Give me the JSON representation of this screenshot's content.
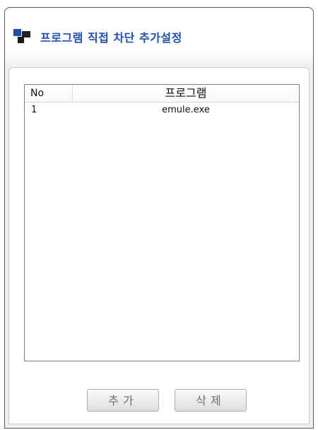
{
  "window": {
    "title": "프로그램 직접 차단 추가설정",
    "icon": "app-window-icon",
    "title_color": "#1c4fb8"
  },
  "list": {
    "columns": [
      "No",
      "프로그램"
    ],
    "rows": [
      {
        "no": "1",
        "program": "emule.exe"
      }
    ]
  },
  "buttons": {
    "add_label": "추가",
    "delete_label": "삭제"
  }
}
